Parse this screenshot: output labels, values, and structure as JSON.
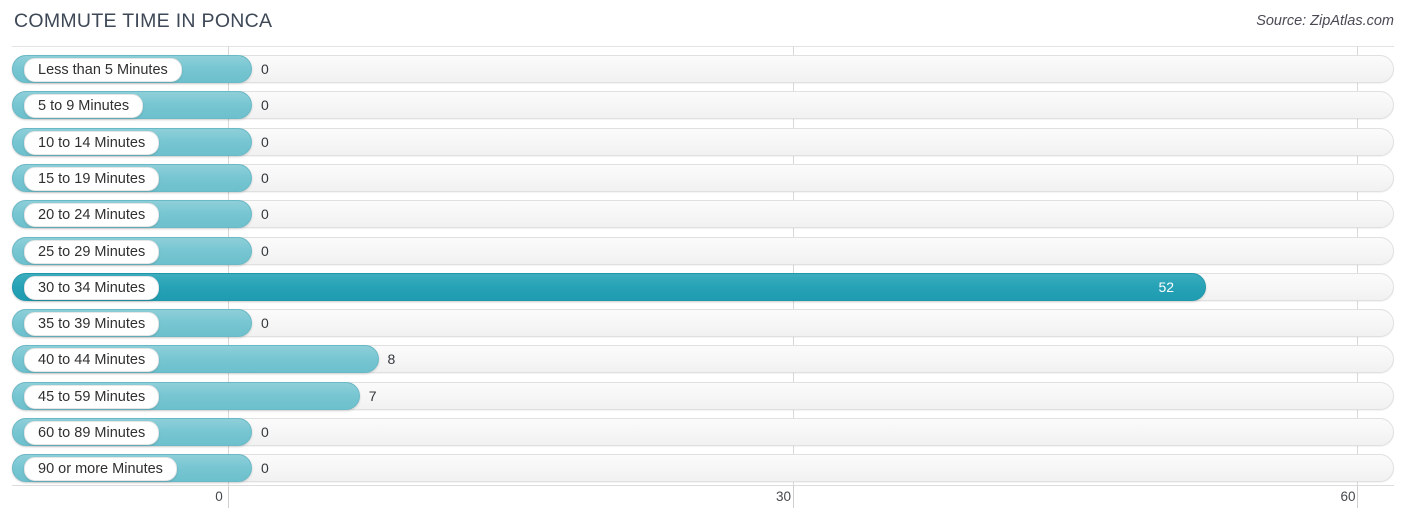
{
  "header": {
    "title": "COMMUTE TIME IN PONCA",
    "source": "Source: ZipAtlas.com"
  },
  "colors": {
    "bar_normal": "#77c6d2",
    "bar_highlight": "#27a2b6",
    "track": "#f6f6f6",
    "gridline": "#d9d9d9",
    "title_text": "#3e4857"
  },
  "chart_data": {
    "type": "bar",
    "orientation": "horizontal",
    "title": "COMMUTE TIME IN PONCA",
    "xlabel": "",
    "ylabel": "",
    "xlim": [
      0,
      60
    ],
    "xticks": [
      0,
      30,
      60
    ],
    "xtick_labels": [
      "0",
      "30",
      "60"
    ],
    "grid": true,
    "legend": false,
    "highlight_category": "30 to 34 Minutes",
    "categories": [
      "Less than 5 Minutes",
      "5 to 9 Minutes",
      "10 to 14 Minutes",
      "15 to 19 Minutes",
      "20 to 24 Minutes",
      "25 to 29 Minutes",
      "30 to 34 Minutes",
      "35 to 39 Minutes",
      "40 to 44 Minutes",
      "45 to 59 Minutes",
      "60 to 89 Minutes",
      "90 or more Minutes"
    ],
    "values": [
      0,
      0,
      0,
      0,
      0,
      0,
      52,
      0,
      8,
      7,
      0,
      0
    ],
    "value_labels": [
      "0",
      "0",
      "0",
      "0",
      "0",
      "0",
      "52",
      "0",
      "8",
      "7",
      "0",
      "0"
    ]
  },
  "rows": [
    {
      "label": "Less than 5 Minutes",
      "value": 0,
      "value_label": "0",
      "highlight": false
    },
    {
      "label": "5 to 9 Minutes",
      "value": 0,
      "value_label": "0",
      "highlight": false
    },
    {
      "label": "10 to 14 Minutes",
      "value": 0,
      "value_label": "0",
      "highlight": false
    },
    {
      "label": "15 to 19 Minutes",
      "value": 0,
      "value_label": "0",
      "highlight": false
    },
    {
      "label": "20 to 24 Minutes",
      "value": 0,
      "value_label": "0",
      "highlight": false
    },
    {
      "label": "25 to 29 Minutes",
      "value": 0,
      "value_label": "0",
      "highlight": false
    },
    {
      "label": "30 to 34 Minutes",
      "value": 52,
      "value_label": "52",
      "highlight": true
    },
    {
      "label": "35 to 39 Minutes",
      "value": 0,
      "value_label": "0",
      "highlight": false
    },
    {
      "label": "40 to 44 Minutes",
      "value": 8,
      "value_label": "8",
      "highlight": false
    },
    {
      "label": "45 to 59 Minutes",
      "value": 7,
      "value_label": "7",
      "highlight": false
    },
    {
      "label": "60 to 89 Minutes",
      "value": 0,
      "value_label": "0",
      "highlight": false
    },
    {
      "label": "90 or more Minutes",
      "value": 0,
      "value_label": "0",
      "highlight": false
    }
  ],
  "axis": {
    "ticks": [
      {
        "label": "0",
        "value": 0
      },
      {
        "label": "30",
        "value": 30
      },
      {
        "label": "60",
        "value": 60
      }
    ]
  }
}
